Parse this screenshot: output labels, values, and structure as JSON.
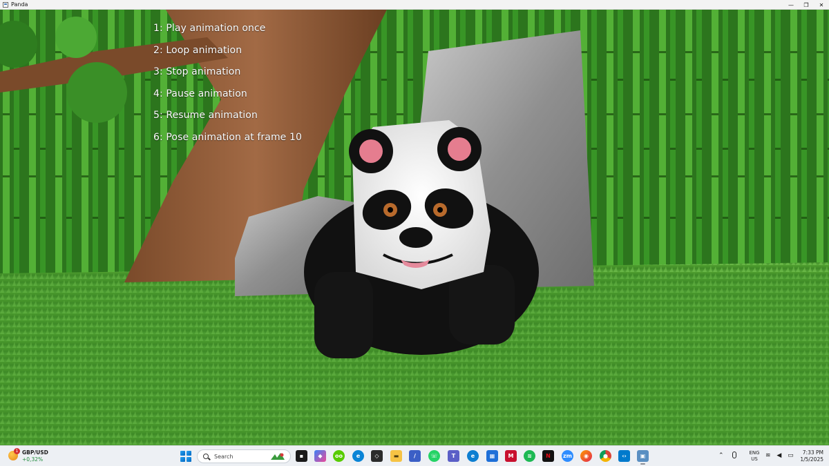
{
  "window": {
    "title": "Panda",
    "controls": {
      "minimize": "—",
      "maximize": "❐",
      "close": "✕"
    }
  },
  "overlay_menu": {
    "items": [
      "1: Play animation once",
      "2: Loop animation",
      "3: Stop animation",
      "4: Pause animation",
      "5: Resume animation",
      "6: Pose animation at frame 10"
    ]
  },
  "taskbar": {
    "widget": {
      "title": "GBP/USD",
      "change": "+0,32%",
      "badge": "1"
    },
    "search": {
      "placeholder": "Search"
    },
    "pinned_icons": [
      "start-icon",
      "search-icon",
      "terminal-icon",
      "copilot-icon",
      "duolingo-icon",
      "edge-icon",
      "unity-icon",
      "file-explorer-icon",
      "visual-studio-icon",
      "whatsapp-icon",
      "teams-icon",
      "edge-browser-icon",
      "store-icon",
      "mcafee-icon",
      "spotify-icon",
      "netflix-icon",
      "zoom-icon",
      "firefox-icon",
      "chrome-icon",
      "vscode-icon",
      "panda-app-icon"
    ],
    "whatsapp_badge": "1",
    "chrome_badge": "1",
    "language": {
      "line1": "ENG",
      "line2": "US"
    },
    "clock": {
      "time": "7:33 PM",
      "date": "1/5/2025"
    }
  }
}
